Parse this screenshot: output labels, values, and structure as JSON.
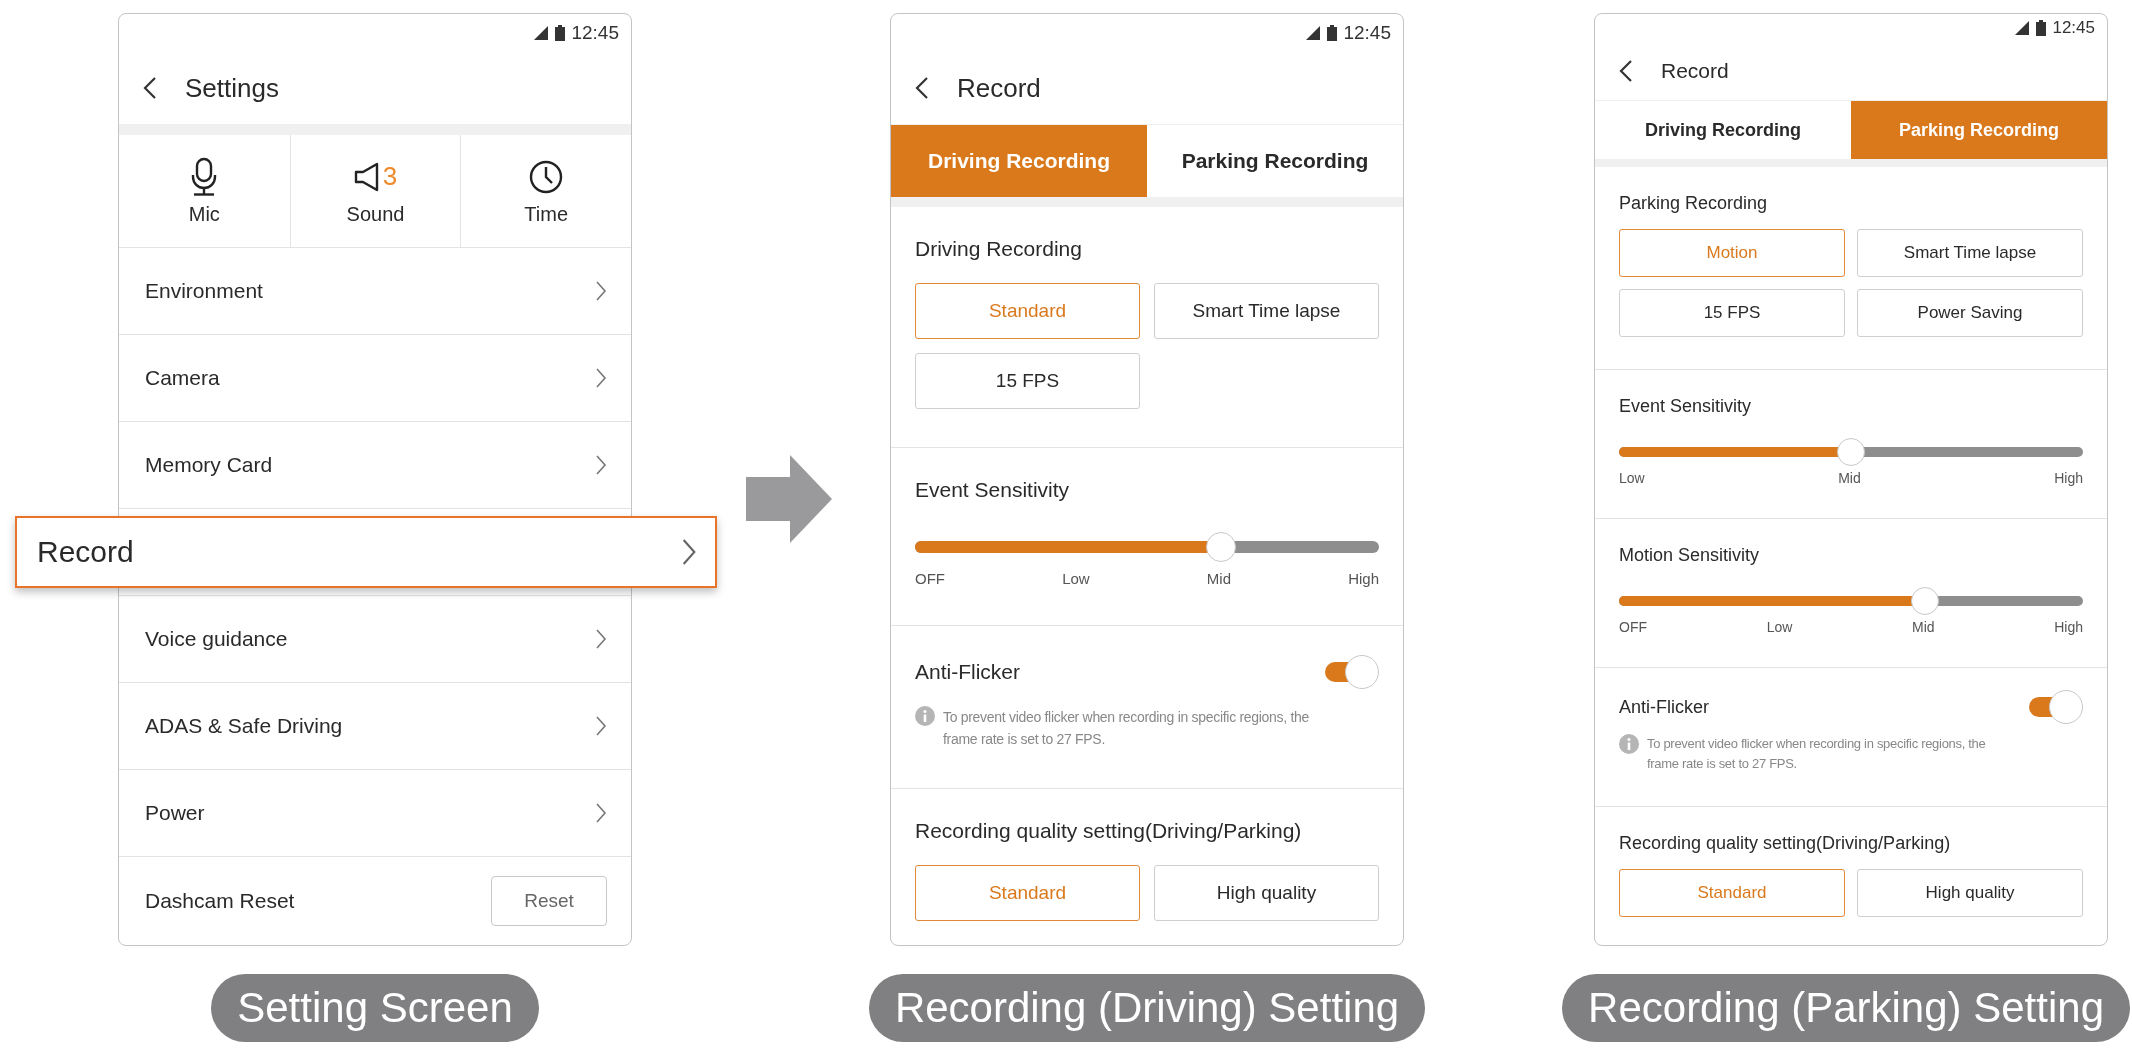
{
  "screens": [
    {
      "kind": "settings",
      "status_time": "12:45",
      "title": "Settings",
      "quick": [
        {
          "label": "Mic"
        },
        {
          "label": "Sound",
          "value": "3"
        },
        {
          "label": "Time"
        }
      ],
      "menu": [
        {
          "label": "Environment",
          "highlighted": false
        },
        {
          "label": "Camera",
          "highlighted": false
        },
        {
          "label": "Memory Card",
          "highlighted": false
        },
        {
          "label": "Record",
          "highlighted": true
        },
        {
          "label": "Voice guidance",
          "highlighted": false
        },
        {
          "label": "ADAS & Safe Driving",
          "highlighted": false
        },
        {
          "label": "Power",
          "highlighted": false
        }
      ],
      "reset": {
        "label": "Dashcam Reset",
        "button": "Reset"
      },
      "caption": "Setting Screen"
    },
    {
      "kind": "record",
      "status_time": "12:45",
      "title": "Record",
      "tabs": [
        {
          "label": "Driving Recording",
          "selected": true
        },
        {
          "label": "Parking Recording",
          "selected": false
        }
      ],
      "sections": [
        {
          "kind": "options",
          "title": "Driving Recording",
          "options": [
            {
              "label": "Standard",
              "selected": true
            },
            {
              "label": "Smart Time lapse",
              "selected": false
            },
            {
              "label": "15 FPS",
              "selected": false
            }
          ]
        },
        {
          "kind": "slider",
          "title": "Event Sensitivity",
          "level": 0.66,
          "ticks": [
            "OFF",
            "Low",
            "Mid",
            "High"
          ]
        },
        {
          "kind": "toggle",
          "title": "Anti-Flicker",
          "on": true,
          "note": "To prevent video flicker when recording in specific regions, the frame rate is set to 27 FPS."
        },
        {
          "kind": "options",
          "title": "Recording quality setting(Driving/Parking)",
          "options": [
            {
              "label": "Standard",
              "selected": true
            },
            {
              "label": "High quality",
              "selected": false
            }
          ]
        }
      ],
      "caption": "Recording (Driving) Setting"
    },
    {
      "kind": "record",
      "status_time": "12:45",
      "title": "Record",
      "tabs": [
        {
          "label": "Driving Recording",
          "selected": false
        },
        {
          "label": "Parking Recording",
          "selected": true
        }
      ],
      "sections": [
        {
          "kind": "options",
          "title": "Parking Recording",
          "options": [
            {
              "label": "Motion",
              "selected": true
            },
            {
              "label": "Smart Time lapse",
              "selected": false
            },
            {
              "label": "15 FPS",
              "selected": false
            },
            {
              "label": "Power Saving",
              "selected": false
            }
          ]
        },
        {
          "kind": "slider",
          "title": "Event Sensitivity",
          "level": 0.5,
          "ticks": [
            "Low",
            "Mid",
            "High"
          ]
        },
        {
          "kind": "slider",
          "title": "Motion Sensitivity",
          "level": 0.66,
          "ticks": [
            "OFF",
            "Low",
            "Mid",
            "High"
          ]
        },
        {
          "kind": "toggle",
          "title": "Anti-Flicker",
          "on": true,
          "note": "To prevent video flicker when recording in specific regions, the frame rate is set to 27 FPS."
        },
        {
          "kind": "options",
          "title": "Recording quality setting(Driving/Parking)",
          "options": [
            {
              "label": "Standard",
              "selected": true
            },
            {
              "label": "High quality",
              "selected": false
            }
          ]
        }
      ],
      "caption": "Recording (Parking) Setting"
    }
  ]
}
